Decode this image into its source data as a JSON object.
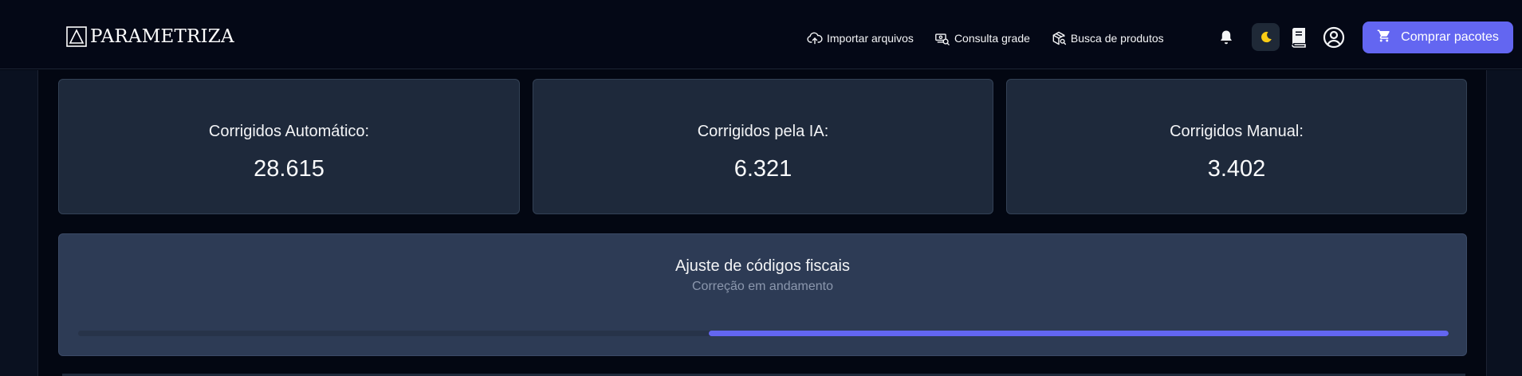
{
  "header": {
    "logo_text": "PARAMETRIZA",
    "nav": [
      {
        "label": "Importar arquivos",
        "icon": "cloud-upload-icon"
      },
      {
        "label": "Consulta grade",
        "icon": "money-search-icon"
      },
      {
        "label": "Busca de produtos",
        "icon": "package-search-icon"
      }
    ],
    "icons": [
      "bell-icon",
      "moon-icon",
      "book-icon",
      "user-circle-icon"
    ],
    "buy_label": "Comprar pacotes",
    "buy_icon": "cart-icon"
  },
  "stats": [
    {
      "label": "Corrigidos Automático:",
      "value": "28.615"
    },
    {
      "label": "Corrigidos pela IA:",
      "value": "6.321"
    },
    {
      "label": "Corrigidos Manual:",
      "value": "3.402"
    }
  ],
  "progress": {
    "title": "Ajuste de códigos fiscais",
    "subtitle": "Correção em andamento",
    "filled_fraction": 0.54
  },
  "colors": {
    "accent": "#6366f1",
    "moon": "#facc15",
    "card": "#1e293b",
    "progress_card": "#2d3b55"
  }
}
